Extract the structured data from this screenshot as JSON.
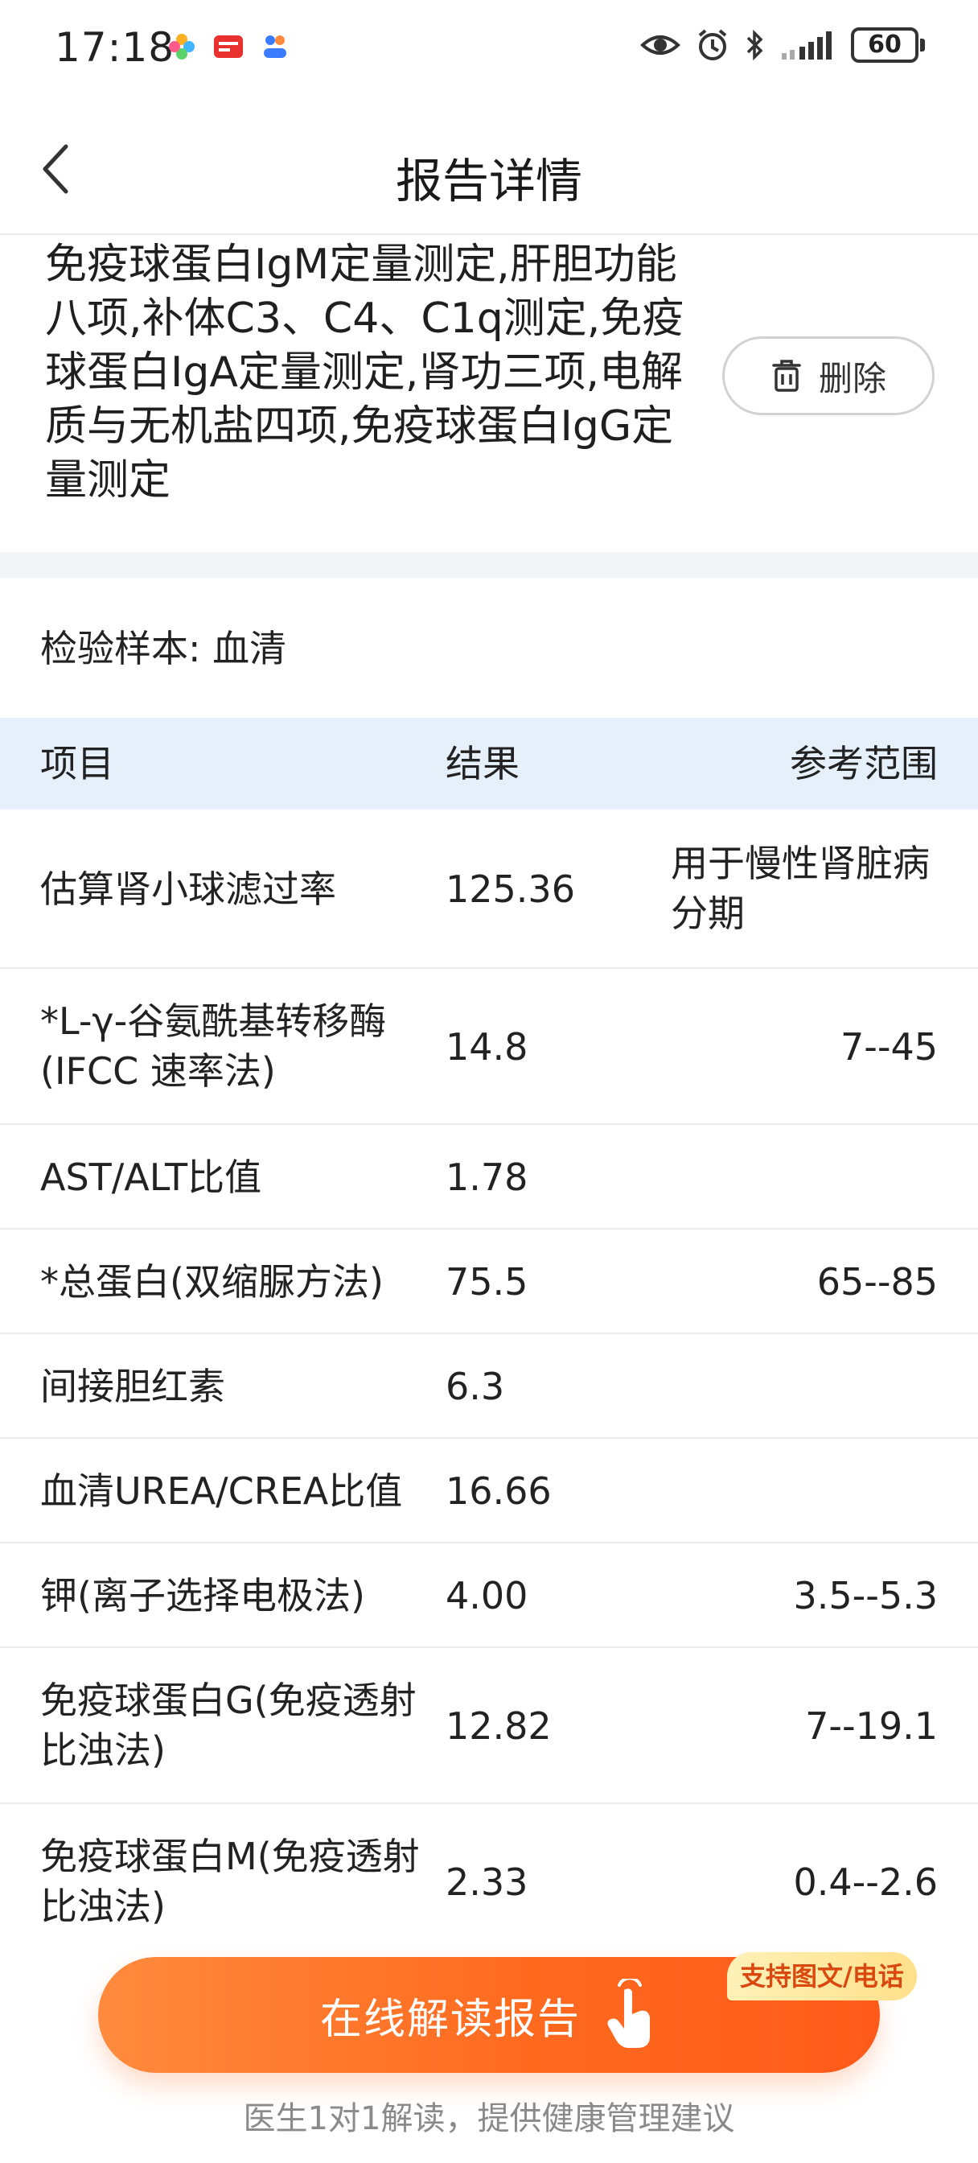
{
  "status_bar": {
    "time": "17:18",
    "battery": "60",
    "icons": [
      "flower-app-icon",
      "yunshanfu-app-icon",
      "health-app-icon",
      "eye-icon",
      "alarm-icon",
      "bluetooth-icon",
      "signal-icon"
    ]
  },
  "header": {
    "title": "报告详情"
  },
  "report": {
    "title": "免疫球蛋白IgM定量测定,肝胆功能八项,补体C3、C4、C1q测定,免疫球蛋白IgA定量测定,肾功三项,电解质与无机盐四项,免疫球蛋白IgG定量测定",
    "delete_label": "删除"
  },
  "sample": {
    "label": "检验样本:",
    "value": "血清"
  },
  "table": {
    "headers": {
      "item": "项目",
      "result": "结果",
      "range": "参考范围"
    },
    "rows": [
      {
        "item": "估算肾小球滤过率",
        "result": "125.36",
        "range": "用于慢性肾脏病分期"
      },
      {
        "item": "*L-γ-谷氨酰基转移酶(IFCC 速率法)",
        "result": "14.8",
        "range": "7--45"
      },
      {
        "item": "AST/ALT比值",
        "result": "1.78",
        "range": ""
      },
      {
        "item": "*总蛋白(双缩脲方法)",
        "result": "75.5",
        "range": "65--85"
      },
      {
        "item": "间接胆红素",
        "result": "6.3",
        "range": ""
      },
      {
        "item": "血清UREA/CREA比值",
        "result": "16.66",
        "range": ""
      },
      {
        "item": "钾(离子选择电极法)",
        "result": "4.00",
        "range": "3.5--5.3"
      },
      {
        "item": "免疫球蛋白G(免疫透射比浊法)",
        "result": "12.82",
        "range": "7--19.1"
      },
      {
        "item": "免疫球蛋白M(免疫透射比浊法)",
        "result": "2.33",
        "range": "0.4--2.6"
      }
    ]
  },
  "cta": {
    "label": "在线解读报告",
    "badge": "支持图文/电话",
    "hint": "医生1对1解读，提供健康管理建议"
  },
  "colors": {
    "accent": "#ff6a1f",
    "table_header_bg": "#e5f0fb",
    "badge_bg": "#ffe08a",
    "badge_text": "#d9480f"
  }
}
